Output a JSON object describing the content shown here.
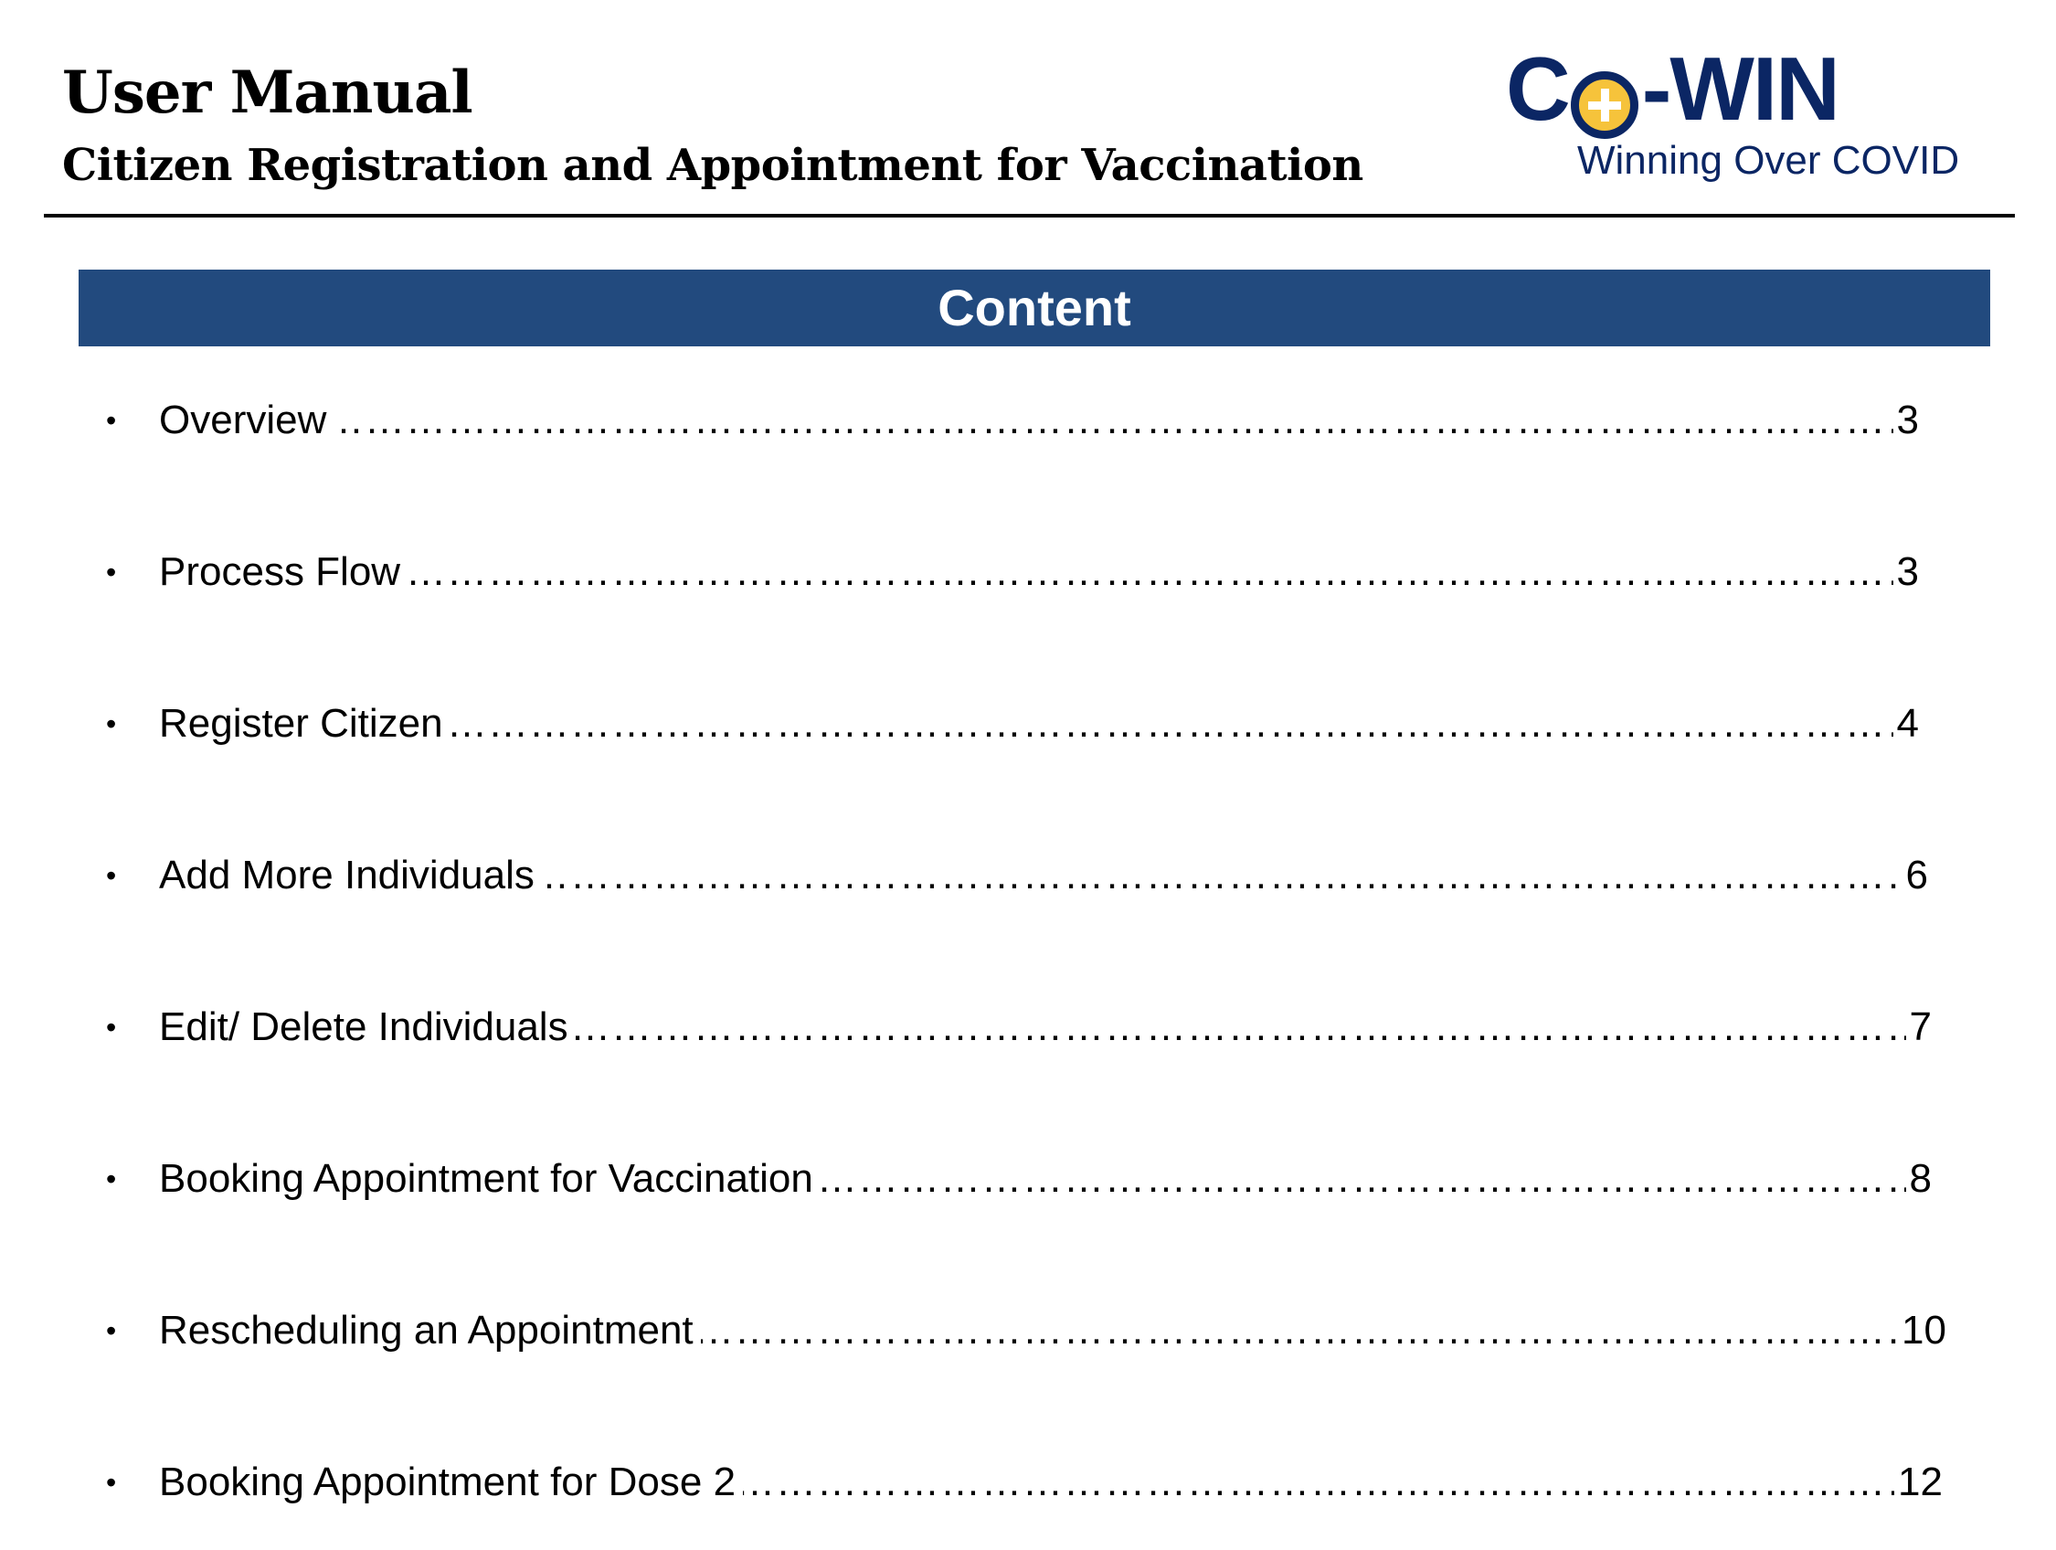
{
  "header": {
    "title": "User Manual",
    "subtitle": "Citizen Registration and Appointment for Vaccination"
  },
  "logo": {
    "word_left": "C",
    "word_right": "-WIN",
    "tagline": "Winning Over COVID",
    "colors": {
      "navy": "#0b2664",
      "plus_fill": "#f6c33b"
    }
  },
  "banner": {
    "label": "Content",
    "color": "#224a7e"
  },
  "toc": [
    {
      "label": "Overview",
      "page": "3"
    },
    {
      "label": "Process Flow",
      "page": "3"
    },
    {
      "label": "Register Citizen",
      "page": "4"
    },
    {
      "label": "Add More Individuals",
      "page": "6"
    },
    {
      "label": "Edit/ Delete Individuals",
      "page": "7"
    },
    {
      "label": "Booking Appointment for Vaccination",
      "page": "8"
    },
    {
      "label": "Rescheduling an Appointment",
      "page": "10"
    },
    {
      "label": "Booking Appointment for Dose 2",
      "page": "12"
    }
  ]
}
